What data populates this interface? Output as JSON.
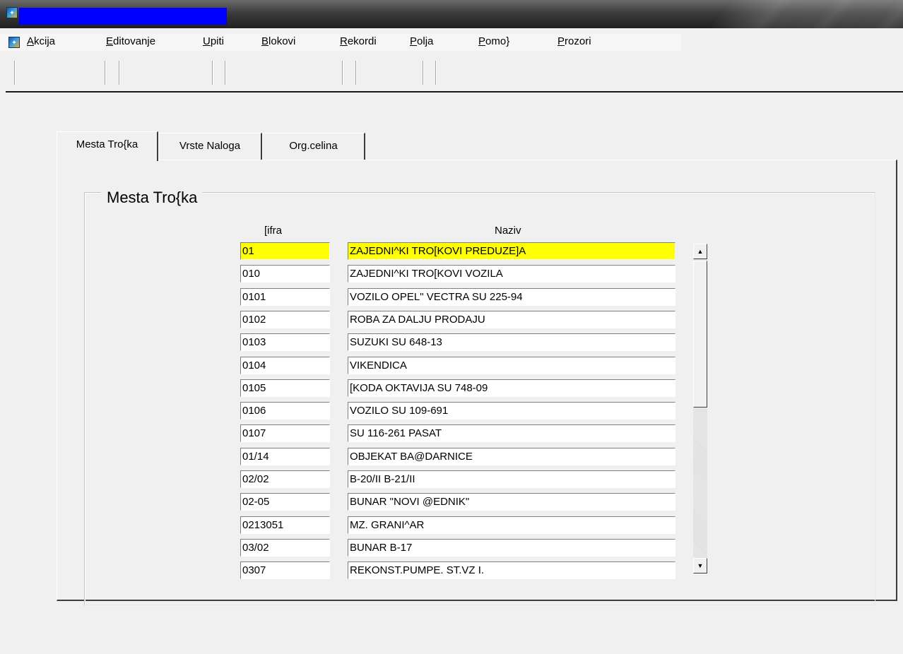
{
  "menu": {
    "items": [
      {
        "mnemonic": "A",
        "rest": "kcija"
      },
      {
        "mnemonic": "E",
        "rest": "ditovanje"
      },
      {
        "mnemonic": "U",
        "rest": "piti"
      },
      {
        "mnemonic": "B",
        "rest": "lokovi"
      },
      {
        "mnemonic": "R",
        "rest": "ekordi"
      },
      {
        "mnemonic": "P",
        "rest": "olja"
      },
      {
        "mnemonic": "P",
        "rest": "omo}"
      },
      {
        "mnemonic": "P",
        "rest": "rozori"
      }
    ]
  },
  "tabs": [
    {
      "label": "Mesta Tro{ka"
    },
    {
      "label": "Vrste Naloga"
    },
    {
      "label": "Org.celina"
    }
  ],
  "group": {
    "title": "Mesta Tro{ka",
    "col_code": "[ifra",
    "col_name": "Naziv"
  },
  "rows": [
    {
      "code": "01",
      "name": "ZAJEDNI^KI TRO[KOVI PREDUZE]A"
    },
    {
      "code": "010",
      "name": "ZAJEDNI^KI TRO[KOVI VOZILA"
    },
    {
      "code": "0101",
      "name": "VOZILO OPEL\" VECTRA SU 225-94"
    },
    {
      "code": "0102",
      "name": "ROBA ZA DALJU PRODAJU"
    },
    {
      "code": "0103",
      "name": "SUZUKI SU 648-13"
    },
    {
      "code": "0104",
      "name": "VIKENDICA"
    },
    {
      "code": "0105",
      "name": "[KODA OKTAVIJA SU 748-09"
    },
    {
      "code": "0106",
      "name": "VOZILO SU 109-691"
    },
    {
      "code": "0107",
      "name": "SU 116-261 PASAT"
    },
    {
      "code": "01/14",
      "name": "OBJEKAT BA@DARNICE"
    },
    {
      "code": "02/02",
      "name": "B-20/II B-21/II"
    },
    {
      "code": "02-05",
      "name": "BUNAR \"NOVI @EDNIK\""
    },
    {
      "code": "0213051",
      "name": "MZ. GRANI^AR"
    },
    {
      "code": "03/02",
      "name": "BUNAR B-17"
    },
    {
      "code": "0307",
      "name": "REKONST.PUMPE. ST.VZ I."
    }
  ],
  "selected_row": 0,
  "colors": {
    "title_field": "#0000ff",
    "selected_row": "#ffff00"
  },
  "icons": {
    "app": "forms-app-icon",
    "scroll_up": "scroll-up-arrow-icon",
    "scroll_down": "scroll-down-arrow-icon"
  }
}
